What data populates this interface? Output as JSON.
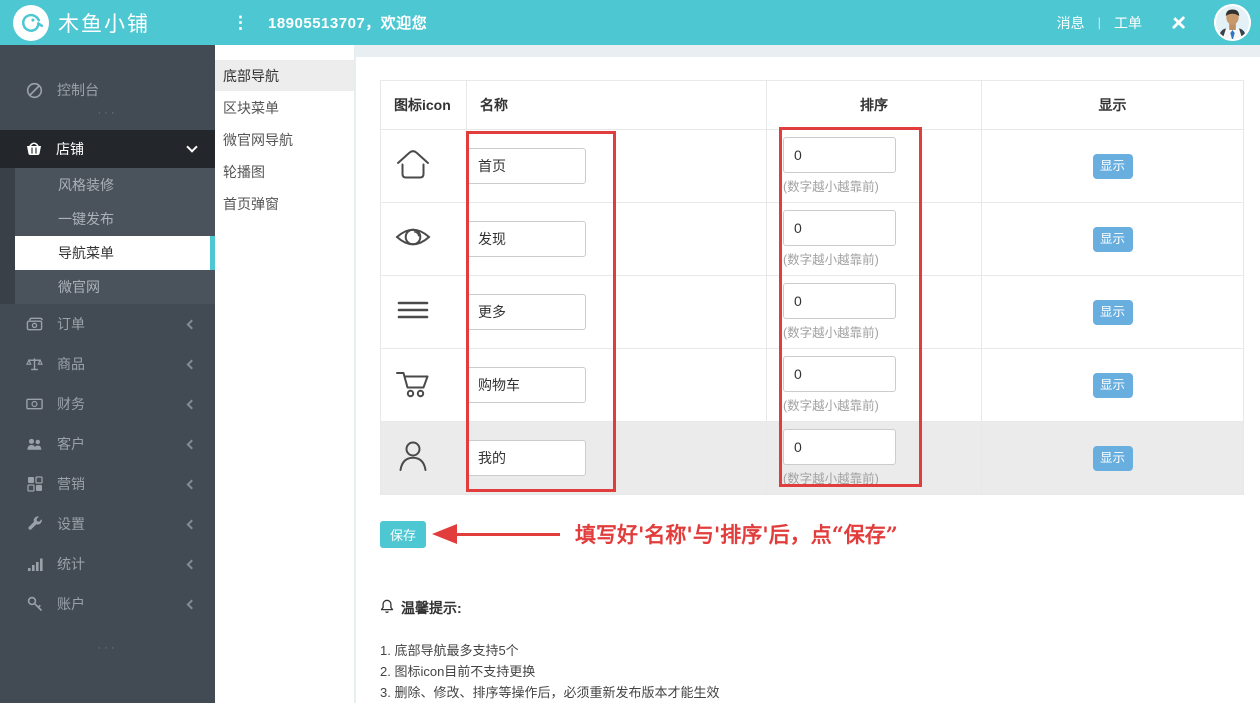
{
  "header": {
    "brand": "木鱼小铺",
    "menu_icon": "⋮",
    "welcome": "18905513707，欢迎您",
    "messages_label": "消息",
    "separator": "|",
    "tickets_label": "工单"
  },
  "sidebar": {
    "console_label": "控制台",
    "dots": "···",
    "shop_label": "店铺",
    "shop_children": [
      "风格装修",
      "一键发布",
      "导航菜单",
      "微官网"
    ],
    "selected_child": "导航菜单",
    "items": [
      "订单",
      "商品",
      "财务",
      "客户",
      "营销",
      "设置",
      "统计",
      "账户"
    ]
  },
  "subnav": {
    "items": [
      "底部导航",
      "区块菜单",
      "微官网导航",
      "轮播图",
      "首页弹窗"
    ],
    "selected": "底部导航"
  },
  "table": {
    "headers": [
      "图标icon",
      "名称",
      "排序",
      "显示"
    ],
    "sort_hint": "(数字越小越靠前)",
    "display_label": "显示",
    "rows": [
      {
        "icon": "home-icon",
        "name": "首页",
        "sort": "0"
      },
      {
        "icon": "discover-eye-icon",
        "name": "发现",
        "sort": "0"
      },
      {
        "icon": "menu-lines-icon",
        "name": "更多",
        "sort": "0"
      },
      {
        "icon": "cart-icon",
        "name": "购物车",
        "sort": "0"
      },
      {
        "icon": "user-icon",
        "name": "我的",
        "sort": "0"
      }
    ]
  },
  "actions": {
    "save_label": "保存",
    "annotation_text": "填写好'名称'与'排序'后，点“保存”"
  },
  "tips": {
    "title": "温馨提示:",
    "lines": [
      "1. 底部导航最多支持5个",
      "2. 图标icon目前不支持更换",
      "3. 删除、修改、排序等操作后，必须重新发布版本才能生效"
    ]
  },
  "colors": {
    "accent_teal": "#4dc7d2",
    "display_button_blue": "#68aede",
    "annotation_red": "#e23d3d",
    "sidebar_bg": "#424a53",
    "sidebar_active_bg": "#23272c",
    "row_highlight": "#ebebeb"
  }
}
